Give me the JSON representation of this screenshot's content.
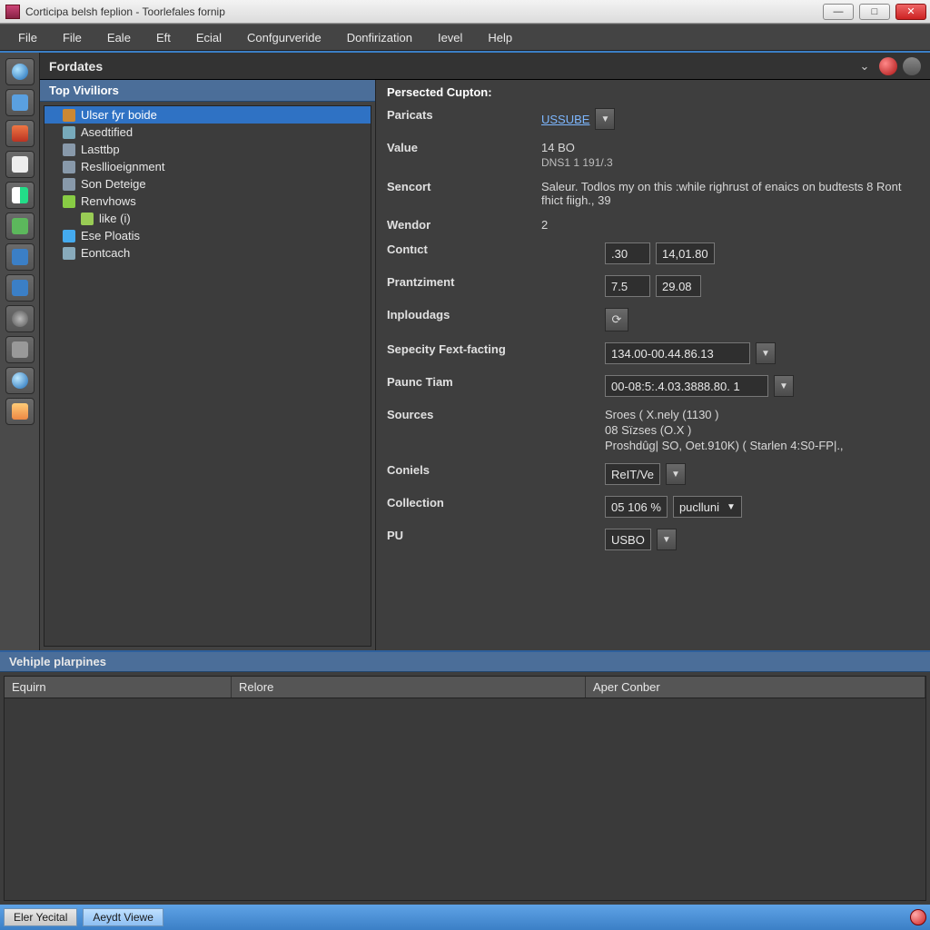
{
  "window": {
    "title": "Corticipa belsh feplion - Toorlefales fornip"
  },
  "menu": [
    "File",
    "File",
    "Eale",
    "Eft",
    "Ecial",
    "Confgurveride",
    "Donfirization",
    "Ievel",
    "Help"
  ],
  "main_panel_title": "Fordates",
  "tree": {
    "title": "Top Viviliors",
    "items": [
      {
        "label": "Ulser fyr boide",
        "icon": "#c83",
        "selected": true
      },
      {
        "label": "Asedtified",
        "icon": "#7ab"
      },
      {
        "label": "Lasttbp",
        "icon": "#89a"
      },
      {
        "label": "Resllioeignment",
        "icon": "#89a"
      },
      {
        "label": "Son Deteige",
        "icon": "#89a"
      },
      {
        "label": "Renvhows",
        "icon": "#8c4"
      },
      {
        "label": "like (i)",
        "icon": "#9c5",
        "indent": true
      },
      {
        "label": "Ese Ploatis",
        "icon": "#4ae"
      },
      {
        "label": "Eontcach",
        "icon": "#8ab"
      }
    ]
  },
  "detail": {
    "header": "Persected Cupton:",
    "paricats_label": "Paricats",
    "paricats_value": "USSUBE",
    "value_label": "Value",
    "value_text": "14 BO",
    "value_sub": "DNS1 1 191/.3",
    "sencort_label": "Sencort",
    "sencort_text": "Saleur. Todlos my on this :while righrust of enaics on budtests 8 Ront fhict fiigh., 39",
    "vendor_label": "Wendor",
    "vendor_value": "2",
    "contact_label": "Contıct",
    "contact_a": ".30",
    "contact_b": "14,01.80",
    "prant_label": "Prantziment",
    "prant_a": "7.5",
    "prant_b": "29.08",
    "inploud_label": "Inploudags",
    "sep_label": "Sepecity Fext-facting",
    "sep_value": "134.00-00.44.86.13",
    "paunc_label": "Paunc Tiam",
    "paunc_value": "00-08:5:.4.03.3888.80. 1",
    "sources_label": "Sources",
    "sources_line1": "Sroes ( X.nely (1130 )",
    "sources_line2": "08 Sïzses (O.X )",
    "sources_line3": "Proshdûg| SO, Oet.910K) ( Starlen 4:S0-FP|.,",
    "coniels_label": "Coniels",
    "coniels_value": "ReIT/Ve",
    "collection_label": "Collection",
    "collection_a": "05 106 %",
    "collection_b": "puclluni",
    "pu_label": "PU",
    "pu_value": "USBO"
  },
  "bottom": {
    "title": "Vehiple plarpines",
    "columns": [
      "Equirn",
      "Relore",
      "Aper Conber"
    ]
  },
  "status": {
    "tab1": "Eler Yecital",
    "tab2": "Aeydt Viewe"
  },
  "tool_colors": [
    "#3b7fc6",
    "#5aa0e0",
    "#c85",
    "#2c8",
    "#ccc",
    "#3b9",
    "#6ad",
    "#2a6",
    "#888",
    "#5bd",
    "#9c7"
  ]
}
